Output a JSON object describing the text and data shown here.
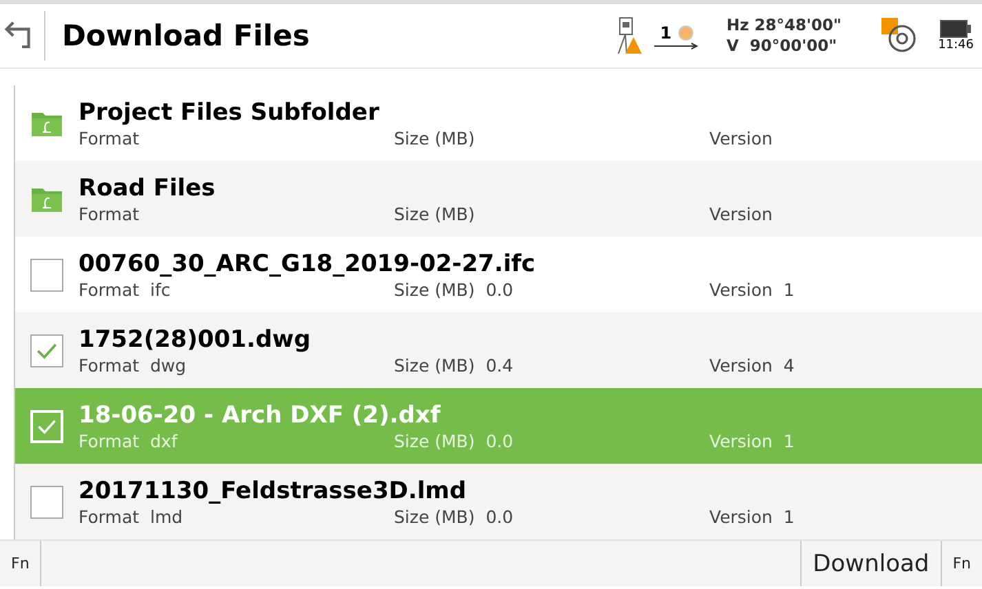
{
  "header": {
    "title": "Download Files",
    "prism_count": "1",
    "hz": "Hz 28°48'00\"",
    "v": "V  90°00'00\"",
    "time": "11:46"
  },
  "items": [
    {
      "kind": "folder",
      "name": "Project Files Subfolder",
      "format_label": "Format",
      "size_label": "Size (MB)",
      "version_label": "Version",
      "selected": false
    },
    {
      "kind": "folder",
      "name": "Road Files",
      "format_label": "Format",
      "size_label": "Size (MB)",
      "version_label": "Version",
      "selected": false
    },
    {
      "kind": "file",
      "name": "00760_30_ARC_G18_2019-02-27.ifc",
      "format_label": "Format",
      "format": "ifc",
      "size_label": "Size (MB)",
      "size": "0.0",
      "version_label": "Version",
      "version": "1",
      "checked": false,
      "selected": false
    },
    {
      "kind": "file",
      "name": "1752(28)001.dwg",
      "format_label": "Format",
      "format": "dwg",
      "size_label": "Size (MB)",
      "size": "0.4",
      "version_label": "Version",
      "version": "4",
      "checked": true,
      "selected": false
    },
    {
      "kind": "file",
      "name": "18-06-20 - Arch DXF (2).dxf",
      "format_label": "Format",
      "format": "dxf",
      "size_label": "Size (MB)",
      "size": "0.0",
      "version_label": "Version",
      "version": "1",
      "checked": true,
      "selected": true
    },
    {
      "kind": "file",
      "name": "20171130_Feldstrasse3D.lmd",
      "format_label": "Format",
      "format": "lmd",
      "size_label": "Size (MB)",
      "size": "0.0",
      "version_label": "Version",
      "version": "1",
      "checked": false,
      "selected": false
    }
  ],
  "footer": {
    "left_fn": "Fn",
    "download": "Download",
    "right_fn": "Fn"
  }
}
